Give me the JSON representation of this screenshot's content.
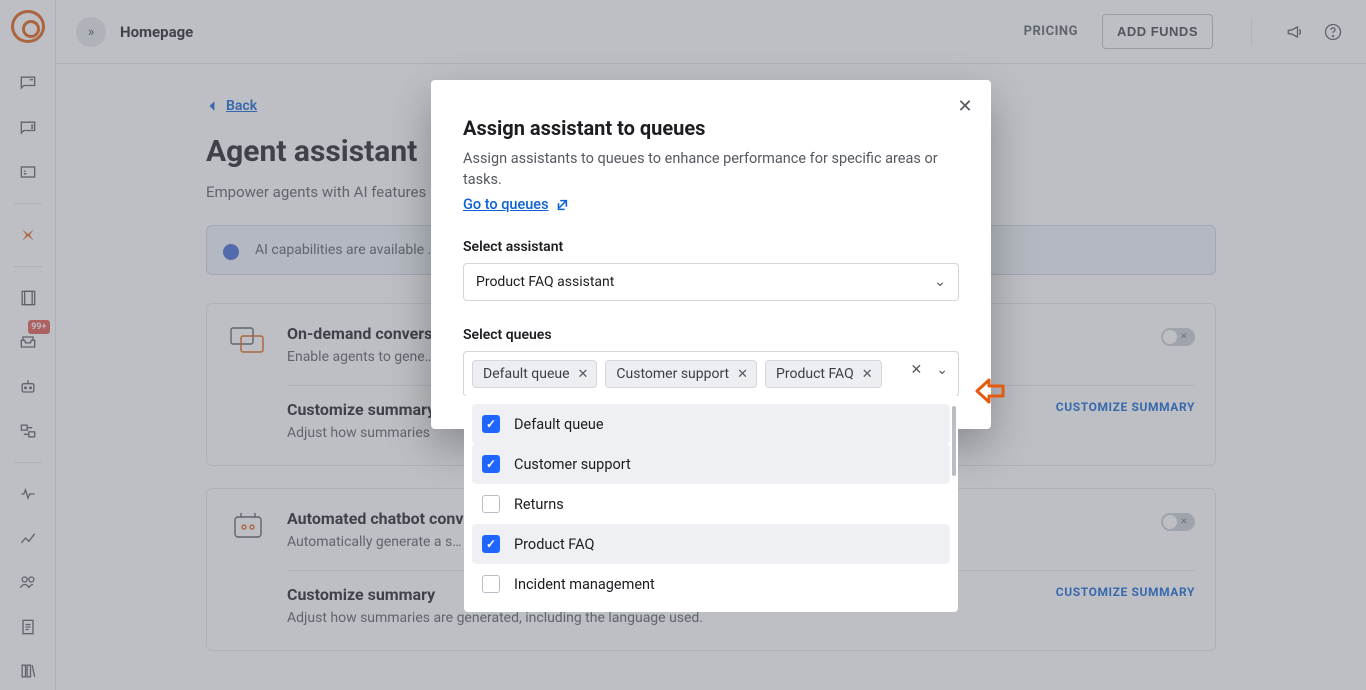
{
  "topbar": {
    "title": "Homepage",
    "pricing": "PRICING",
    "add_funds": "ADD FUNDS"
  },
  "rail": {
    "badge": "99+"
  },
  "page": {
    "back": "Back",
    "h1": "Agent assistant",
    "sub": "Empower agents with AI features",
    "info": "AI capabilities are available … your account manager or our support team.",
    "cards": [
      {
        "title": "On-demand conversa…",
        "desc": "Enable agents to gene… chatbot and agent int…",
        "cs_title": "Customize summary",
        "cs_desc": "Adjust how summaries",
        "cs_action": "CUSTOMIZE SUMMARY"
      },
      {
        "title": "Automated chatbot conve…",
        "desc": "Automatically generate a s… handoff. Chatbot summary…",
        "cs_title": "Customize summary",
        "cs_desc": "Adjust how summaries are generated, including the language used.",
        "cs_action": "CUSTOMIZE SUMMARY"
      }
    ]
  },
  "modal": {
    "title": "Assign assistant to queues",
    "desc": "Assign assistants to queues to enhance performance for specific areas or tasks.",
    "link": "Go to queues",
    "select_assistant_label": "Select assistant",
    "assistant_value": "Product FAQ assistant",
    "select_queues_label": "Select queues",
    "chips": [
      "Default queue",
      "Customer support",
      "Product FAQ"
    ],
    "options": [
      {
        "label": "Default queue",
        "checked": true
      },
      {
        "label": "Customer support",
        "checked": true
      },
      {
        "label": "Returns",
        "checked": false
      },
      {
        "label": "Product FAQ",
        "checked": true
      },
      {
        "label": "Incident management",
        "checked": false
      }
    ]
  }
}
